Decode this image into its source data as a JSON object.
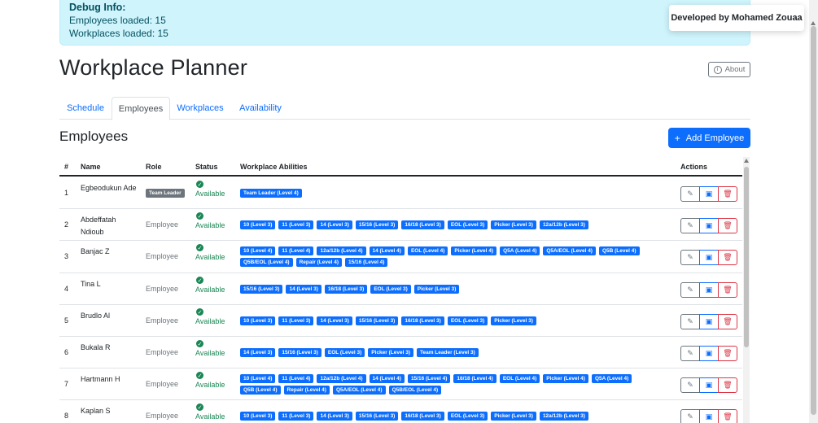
{
  "debug": {
    "title": "Debug Info:",
    "employees_loaded": "Employees loaded: 15",
    "workplaces_loaded": "Workplaces loaded: 15"
  },
  "developer_credit": "Developed by Mohamed Zouaa",
  "app_title": "Workplace Planner",
  "about_label": "About",
  "tabs": [
    {
      "label": "Schedule",
      "active": false
    },
    {
      "label": "Employees",
      "active": true
    },
    {
      "label": "Workplaces",
      "active": false
    },
    {
      "label": "Availability",
      "active": false
    }
  ],
  "section_title": "Employees",
  "add_button_label": "Add Employee",
  "table": {
    "headers": {
      "num": "#",
      "name": "Name",
      "role": "Role",
      "status": "Status",
      "abilities": "Workplace Abilities",
      "actions": "Actions"
    },
    "rows": [
      {
        "num": "1",
        "name": "Egbeodukun Ade",
        "role": "Team Leader",
        "role_badge": true,
        "status": "Available",
        "abilities": [
          "Team Leader (Level 4)"
        ]
      },
      {
        "num": "2",
        "name": "Abdeffatah Ndioub",
        "role": "Employee",
        "role_badge": false,
        "status": "Available",
        "abilities": [
          "10 (Level 3)",
          "11 (Level 3)",
          "14 (Level 3)",
          "15/16 (Level 3)",
          "16/18 (Level 3)",
          "EOL (Level 3)",
          "Picker (Level 3)",
          "12a/12b (Level 3)"
        ]
      },
      {
        "num": "3",
        "name": "Banjac Z",
        "role": "Employee",
        "role_badge": false,
        "status": "Available",
        "abilities": [
          "10 (Level 4)",
          "11 (Level 4)",
          "12a/12b (Level 4)",
          "14 (Level 4)",
          "EOL (Level 4)",
          "Picker (Level 4)",
          "Q5A (Level 4)",
          "Q5A/EOL (Level 4)",
          "Q5B (Level 4)",
          "Q5B/EOL (Level 4)",
          "Repair (Level 4)",
          "15/16 (Level 4)"
        ]
      },
      {
        "num": "4",
        "name": "Tina L",
        "role": "Employee",
        "role_badge": false,
        "status": "Available",
        "abilities": [
          "15/16 (Level 3)",
          "14 (Level 3)",
          "16/18 (Level 3)",
          "EOL (Level 3)",
          "Picker (Level 3)"
        ]
      },
      {
        "num": "5",
        "name": "Brudlo Al",
        "role": "Employee",
        "role_badge": false,
        "status": "Available",
        "abilities": [
          "10 (Level 3)",
          "11 (Level 3)",
          "14 (Level 3)",
          "15/16 (Level 3)",
          "16/18 (Level 3)",
          "EOL (Level 3)",
          "Picker (Level 3)"
        ]
      },
      {
        "num": "6",
        "name": "Bukala R",
        "role": "Employee",
        "role_badge": false,
        "status": "Available",
        "abilities": [
          "14 (Level 3)",
          "15/16 (Level 3)",
          "EOL (Level 3)",
          "Picker (Level 3)",
          "Team Leader (Level 3)"
        ]
      },
      {
        "num": "7",
        "name": "Hartmann H",
        "role": "Employee",
        "role_badge": false,
        "status": "Available",
        "abilities": [
          "10 (Level 4)",
          "11 (Level 4)",
          "12a/12b (Level 4)",
          "14 (Level 4)",
          "15/16 (Level 4)",
          "16/18 (Level 4)",
          "EOL (Level 4)",
          "Picker (Level 4)",
          "Q5A (Level 4)",
          "Q5B (Level 4)",
          "Repair (Level 4)",
          "Q5A/EOL (Level 4)",
          "Q5B/EOL (Level 4)"
        ]
      },
      {
        "num": "8",
        "name": "Kaplan S",
        "role": "Employee",
        "role_badge": false,
        "status": "Available",
        "abilities": [
          "10 (Level 3)",
          "11 (Level 3)",
          "14 (Level 3)",
          "15/16 (Level 3)",
          "16/18 (Level 3)",
          "EOL (Level 3)",
          "Picker (Level 3)",
          "12a/12b (Level 3)"
        ]
      }
    ]
  },
  "colors": {
    "primary": "#0d6efd",
    "success": "#198754",
    "danger": "#dc3545",
    "secondary": "#6c757d",
    "info_bg": "#cff4fc"
  },
  "icons": {
    "edit": "pencil-icon",
    "schedule": "calendar-check-icon",
    "delete": "trash-icon",
    "about": "info-circle-icon",
    "add": "plus-icon",
    "status": "check-circle-icon"
  }
}
